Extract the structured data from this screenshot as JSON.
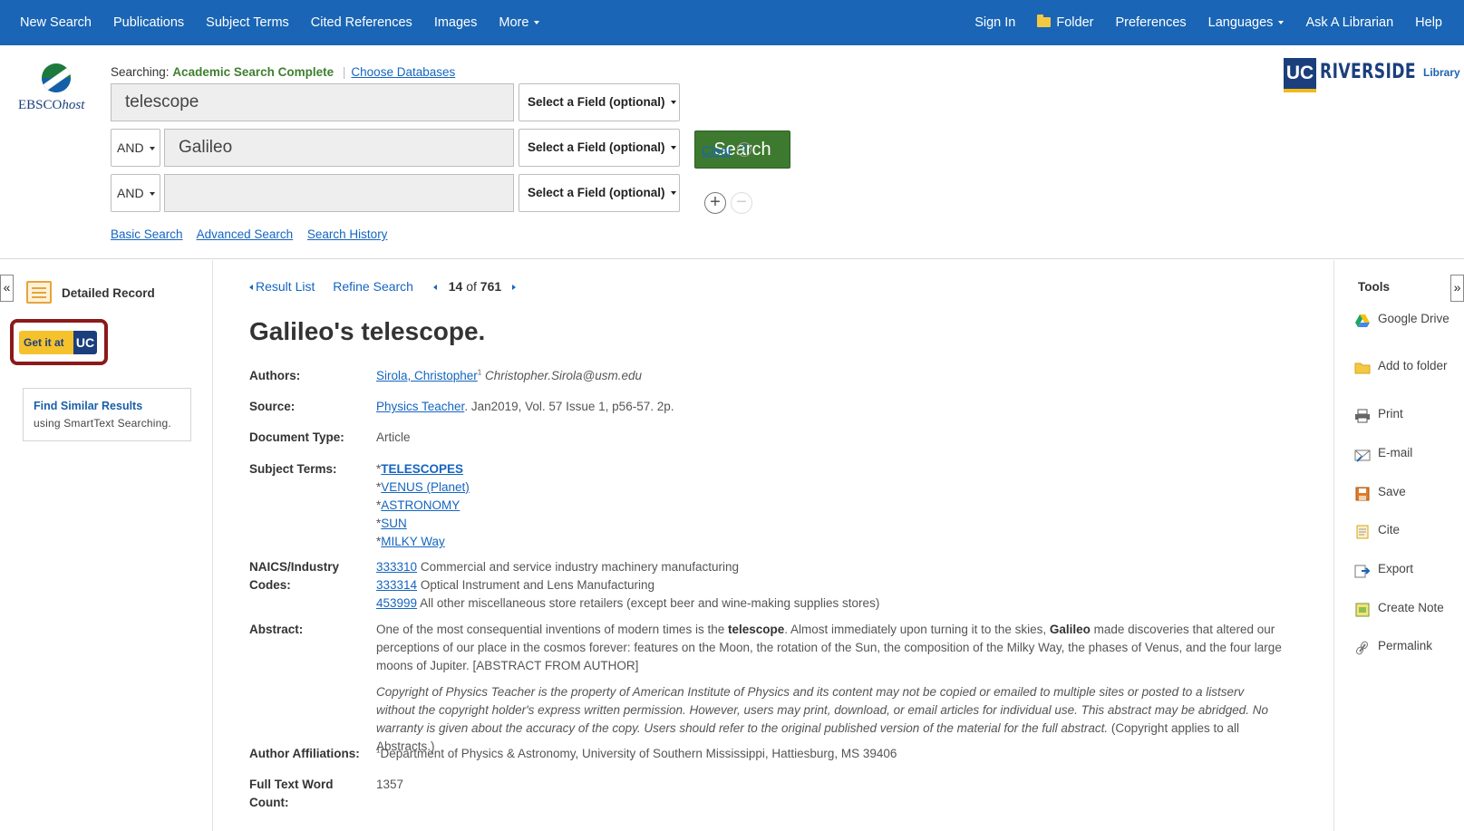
{
  "topnav": {
    "left": [
      "New Search",
      "Publications",
      "Subject Terms",
      "Cited References",
      "Images",
      "More"
    ],
    "right": [
      "Sign In",
      "Folder",
      "Preferences",
      "Languages",
      "Ask A Librarian",
      "Help"
    ]
  },
  "header": {
    "logo_main": "EBSCO",
    "logo_suffix": "host",
    "searching_label": "Searching:",
    "database": "Academic Search Complete",
    "choose_databases": "Choose Databases",
    "rows": [
      {
        "bool": "",
        "term": "telescope",
        "field": "Select a Field (optional)"
      },
      {
        "bool": "AND",
        "term": "Galileo",
        "field": "Select a Field (optional)"
      },
      {
        "bool": "AND",
        "term": "",
        "field": "Select a Field (optional)"
      }
    ],
    "search_button": "Search",
    "clear": "Clear",
    "help": "?",
    "links": [
      "Basic Search",
      "Advanced Search",
      "Search History"
    ],
    "ucr": {
      "uc": "UC",
      "riverside": "RIVERSIDE",
      "library": "Library"
    }
  },
  "left": {
    "collapse": "«",
    "detailed_record": "Detailed Record",
    "getit": {
      "text": "Get it at",
      "uc": "UC"
    },
    "similar_title": "Find Similar Results",
    "similar_sub": "using SmartText Searching."
  },
  "main": {
    "result_list": "Result List",
    "refine_search": "Refine Search",
    "position": "14",
    "of": "of",
    "total": "761",
    "title": "Galileo's telescope.",
    "labels": {
      "authors": "Authors:",
      "source": "Source:",
      "doctype": "Document Type:",
      "subjects": "Subject Terms:",
      "naics": "NAICS/Industry Codes:",
      "abstract": "Abstract:",
      "affiliations": "Author Affiliations:",
      "wordcount": "Full Text Word Count:"
    },
    "author_name": "Sirola, Christopher",
    "author_sup": "1",
    "author_email": "Christopher.Sirola@usm.edu",
    "source_link": "Physics Teacher",
    "source_rest": ". Jan2019, Vol. 57 Issue 1, p56-57. 2p.",
    "doctype": "Article",
    "subjects": [
      "TELESCOPES",
      "VENUS (Planet)",
      "ASTRONOMY",
      "SUN",
      "MILKY Way"
    ],
    "naics": [
      {
        "code": "333310",
        "desc": "Commercial and service industry machinery manufacturing"
      },
      {
        "code": "333314",
        "desc": "Optical Instrument and Lens Manufacturing"
      },
      {
        "code": "453999",
        "desc": "All other miscellaneous store retailers (except beer and wine-making supplies stores)"
      }
    ],
    "abstract_1": "One of the most consequential inventions of modern times is the ",
    "abstract_b1": "telescope",
    "abstract_2": ". Almost immediately upon turning it to the skies, ",
    "abstract_b2": "Galileo",
    "abstract_3": " made discoveries that altered our perceptions of our place in the cosmos forever: features on the Moon, the rotation of the Sun, the composition of the Milky Way, the phases of Venus, and the four large moons of Jupiter. [ABSTRACT FROM AUTHOR]",
    "copyright_italic": "Copyright of Physics Teacher is the property of American Institute of Physics and its content may not be copied or emailed to multiple sites or posted to a listserv without the copyright holder's express written permission. However, users may print, download, or email articles for individual use. This abstract may be abridged. No warranty is given about the accuracy of the copy. Users should refer to the original published version of the material for the full abstract.",
    "copyright_plain": " (Copyright applies to all Abstracts.)",
    "affiliation_sup": "1",
    "affiliation": "Department of Physics & Astronomy, University of Southern Mississippi, Hattiesburg, MS 39406",
    "wordcount": "1357"
  },
  "tools": {
    "collapse": "»",
    "title": "Tools",
    "items": [
      "Google Drive",
      "Add to folder",
      "Print",
      "E-mail",
      "Save",
      "Cite",
      "Export",
      "Create Note",
      "Permalink"
    ],
    "icons": [
      "google-drive-icon",
      "add-folder-icon",
      "print-icon",
      "email-icon",
      "save-icon",
      "cite-icon",
      "export-icon",
      "create-note-icon",
      "permalink-icon"
    ]
  }
}
